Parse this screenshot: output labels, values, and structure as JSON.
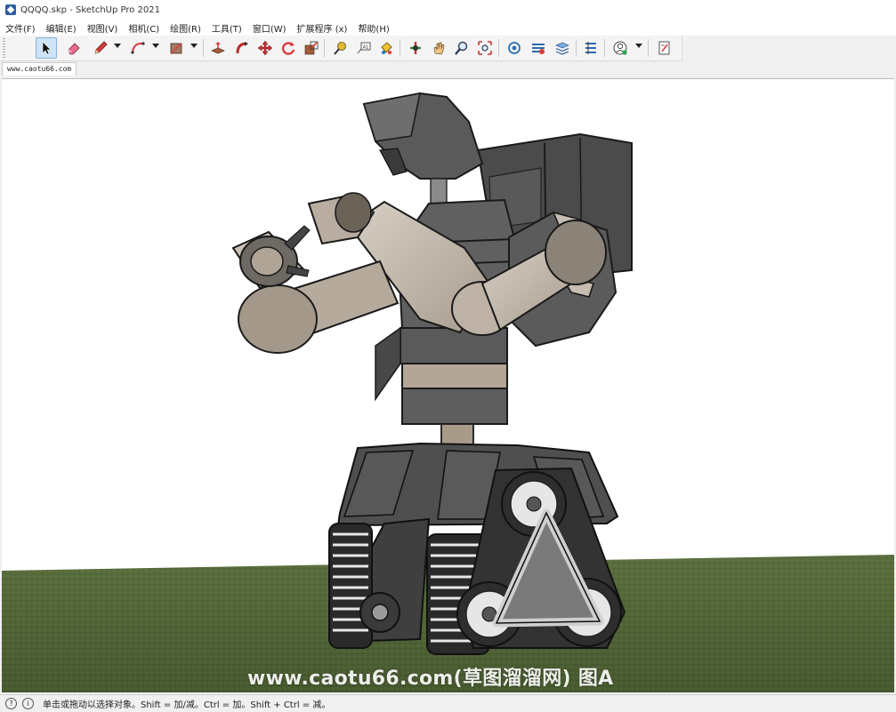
{
  "window": {
    "title": "QQQQ.skp - SketchUp Pro 2021"
  },
  "menu": [
    "文件(F)",
    "编辑(E)",
    "视图(V)",
    "相机(C)",
    "绘图(R)",
    "工具(T)",
    "窗口(W)",
    "扩展程序 (x)",
    "帮助(H)"
  ],
  "scene_tab": "www.caotu66.com",
  "watermark": "www.caotu66.com(草图溜溜网) 图A",
  "status": {
    "text": "单击或拖动以选择对象。Shift = 加/减。Ctrl = 加。Shift + Ctrl = 减。"
  },
  "colors": {
    "accent": "#cde3f7",
    "ground": "#4f6a36",
    "robot_dark": "#555555",
    "robot_light": "#c2b9ad"
  }
}
